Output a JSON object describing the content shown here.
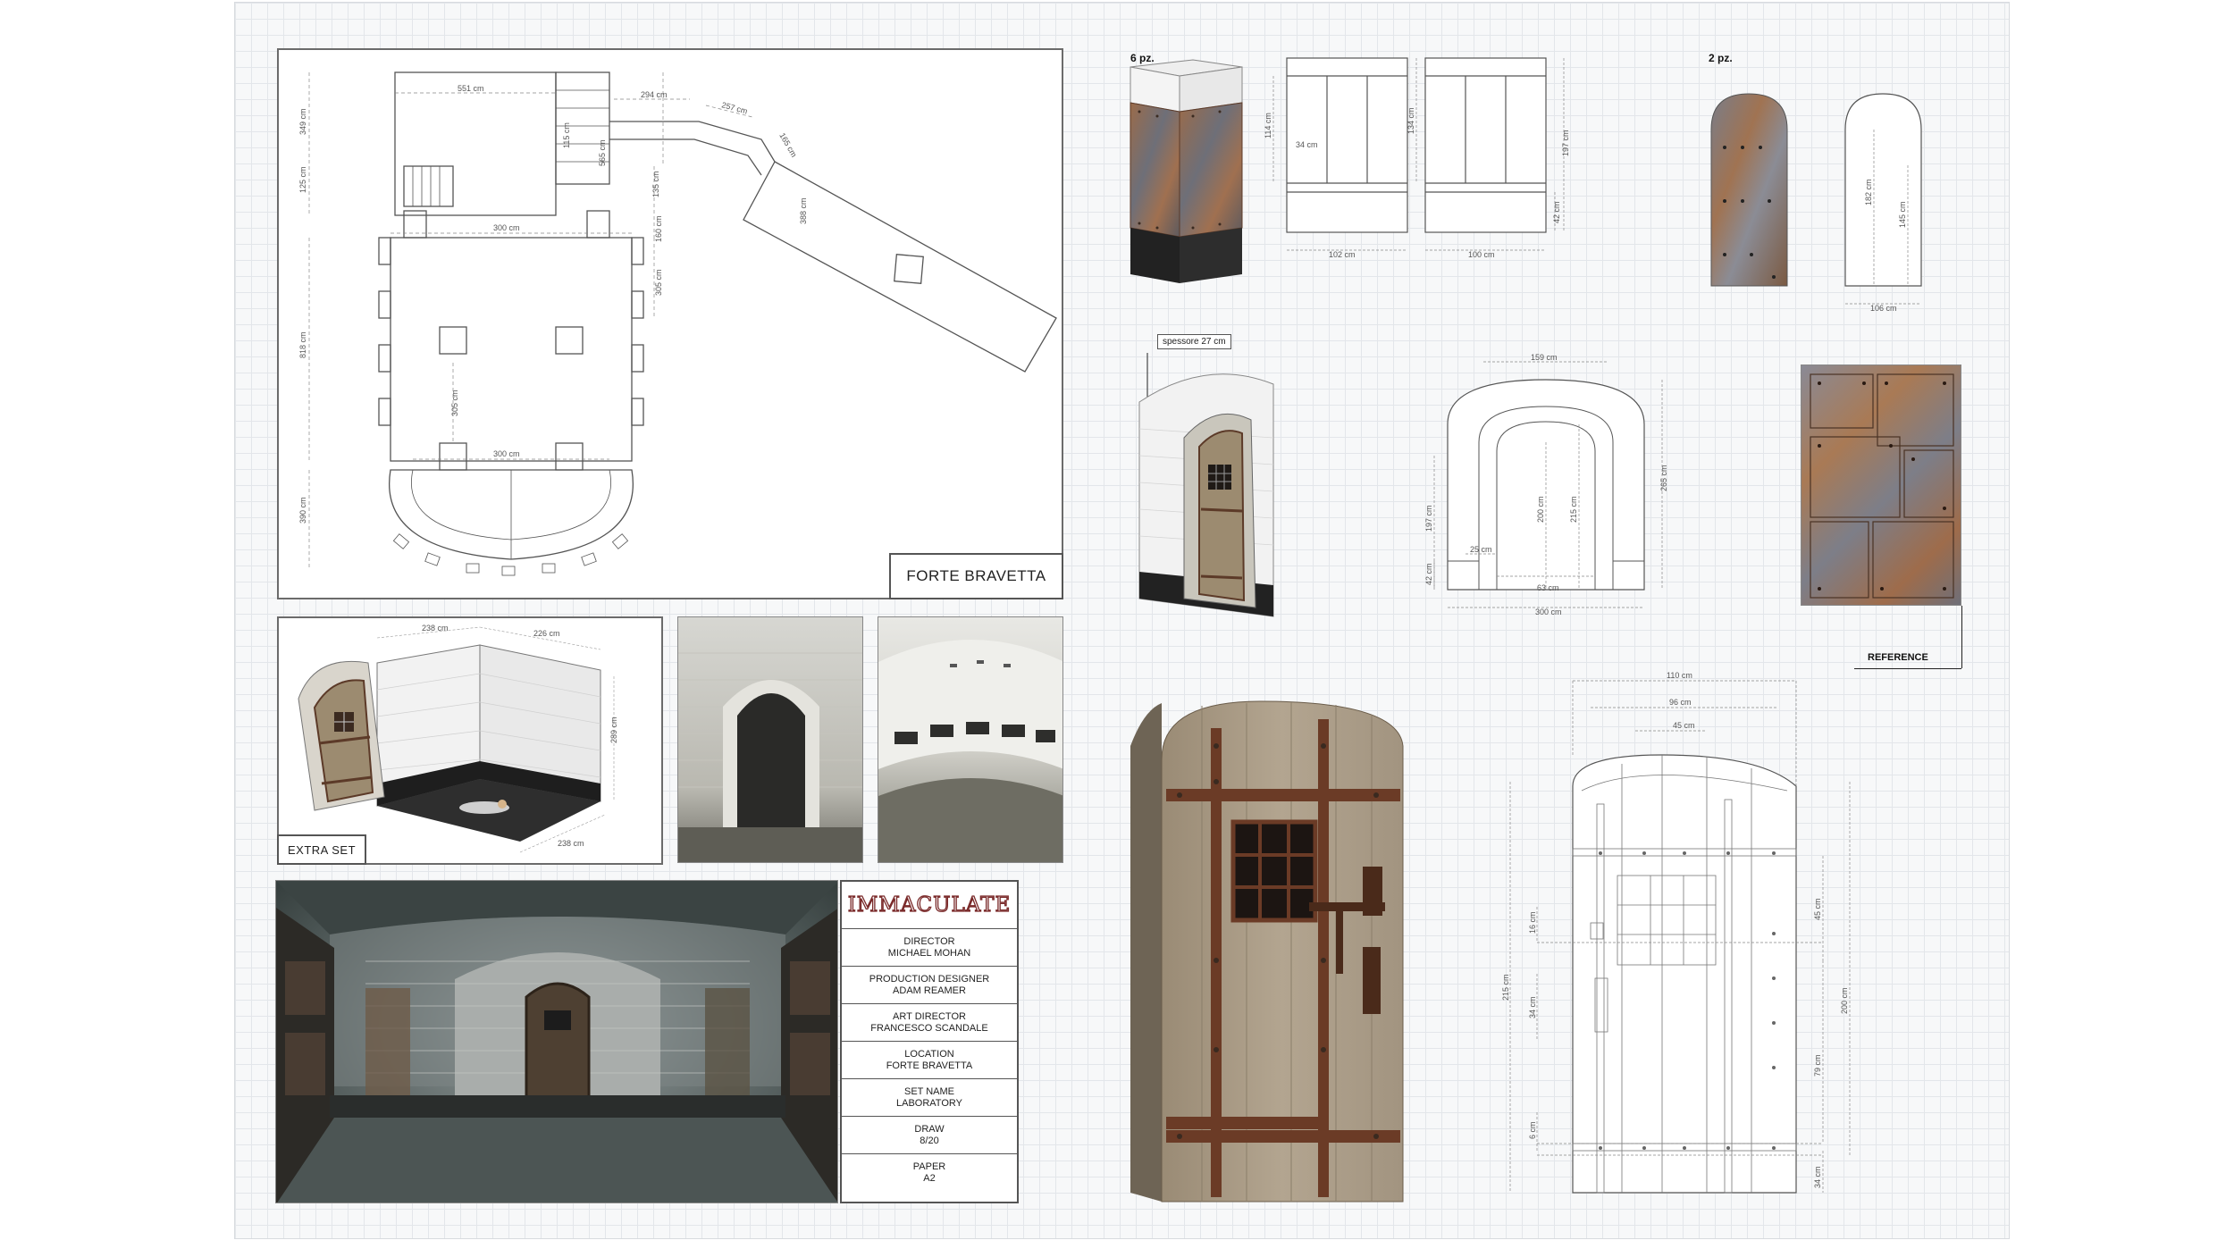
{
  "floor_plan": {
    "title": "FORTE BRAVETTA",
    "dims": [
      "551 cm",
      "294 cm",
      "257 cm",
      "165 cm",
      "349 cm",
      "125 cm",
      "565 cm",
      "115 cm",
      "135 cm",
      "300 cm",
      "160 cm",
      "305 cm",
      "818 cm",
      "305 cm",
      "300 cm",
      "390 cm",
      "388 cm"
    ]
  },
  "extra_set": {
    "title": "EXTRA SET",
    "dims": [
      "238 cm",
      "226 cm",
      "289 cm",
      "238 cm"
    ]
  },
  "pillar": {
    "count_label": "6 pz.",
    "dims": [
      "114 cm",
      "34 cm",
      "102 cm",
      "134 cm",
      "197 cm",
      "42 cm",
      "100 cm"
    ]
  },
  "door_small": {
    "count_label": "2 pz.",
    "dims": [
      "182 cm",
      "145 cm",
      "106 cm"
    ]
  },
  "arch": {
    "thickness_label": "spessore 27 cm",
    "dims": [
      "159 cm",
      "197 cm",
      "42 cm",
      "25 cm",
      "200 cm",
      "215 cm",
      "265 cm",
      "63 cm",
      "300 cm"
    ]
  },
  "reference_label": "REFERENCE",
  "door_detail": {
    "dims": [
      "110 cm",
      "96 cm",
      "45 cm",
      "16 cm",
      "45 cm",
      "215 cm",
      "34 cm",
      "79 cm",
      "200 cm",
      "6 cm",
      "34 cm"
    ]
  },
  "title_block": {
    "logo": "IMMACULATE",
    "rows": [
      {
        "label": "DIRECTOR",
        "value": "MICHAEL MOHAN"
      },
      {
        "label": "PRODUCTION DESIGNER",
        "value": "ADAM REAMER"
      },
      {
        "label": "ART DIRECTOR",
        "value": "FRANCESCO SCANDALE"
      },
      {
        "label": "LOCATION",
        "value": "FORTE BRAVETTA"
      },
      {
        "label": "SET NAME",
        "value": "LABORATORY"
      },
      {
        "label": "DRAW",
        "value": "8/20"
      },
      {
        "label": "PAPER",
        "value": "A2"
      }
    ]
  },
  "colors": {
    "rust": "#8a5a3a",
    "wood": "#a89880",
    "iron": "#5c3a28",
    "logo_red": "#7a2a2a"
  }
}
